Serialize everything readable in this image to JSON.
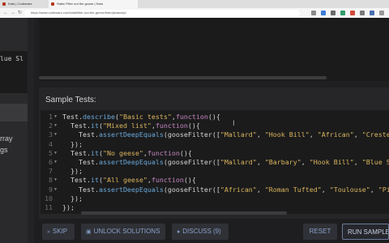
{
  "browser": {
    "tabs": [
      {
        "label": "Kata | Codewars"
      },
      {
        "label": "Static Filter not the goose | Kata"
      }
    ],
    "url": "https://www.codewars.com/kata/filter-out-the-geese/train/javascript"
  },
  "left_panel": {
    "code_fragment": "lue Sl",
    "text_lines": [
      "rray",
      "gs"
    ]
  },
  "tests": {
    "title": "Sample Tests:",
    "lines": [
      {
        "n": "1",
        "fold": true,
        "segments": [
          [
            "id",
            "Test."
          ],
          [
            "fn",
            "describe"
          ],
          [
            "id",
            "("
          ],
          [
            "str",
            "\"Basic tests\""
          ],
          [
            "id",
            ","
          ],
          [
            "kw",
            "function"
          ],
          [
            "id",
            "(){"
          ]
        ]
      },
      {
        "n": "2",
        "fold": true,
        "segments": [
          [
            "id",
            "  Test."
          ],
          [
            "fn",
            "it"
          ],
          [
            "id",
            "("
          ],
          [
            "str",
            "\"Mixed list\""
          ],
          [
            "id",
            ","
          ],
          [
            "kw",
            "function"
          ],
          [
            "id",
            "(){"
          ]
        ]
      },
      {
        "n": "3",
        "fold": true,
        "segments": [
          [
            "id",
            "    Test."
          ],
          [
            "fn",
            "assertDeepEquals"
          ],
          [
            "id",
            "(gooseFilter(["
          ],
          [
            "str",
            "\"Mallard\""
          ],
          [
            "id",
            ", "
          ],
          [
            "str",
            "\"Hook Bill\""
          ],
          [
            "id",
            ", "
          ],
          [
            "str",
            "\"African\""
          ],
          [
            "id",
            ", "
          ],
          [
            "str",
            "\"Crested\""
          ]
        ]
      },
      {
        "n": "4",
        "fold": false,
        "segments": [
          [
            "id",
            "  });"
          ]
        ]
      },
      {
        "n": "5",
        "fold": true,
        "segments": [
          [
            "id",
            "  Test."
          ],
          [
            "fn",
            "it"
          ],
          [
            "id",
            "("
          ],
          [
            "str",
            "\"No geese\""
          ],
          [
            "id",
            ","
          ],
          [
            "kw",
            "function"
          ],
          [
            "id",
            "(){"
          ]
        ]
      },
      {
        "n": "6",
        "fold": true,
        "segments": [
          [
            "id",
            "    Test."
          ],
          [
            "fn",
            "assertDeepEquals"
          ],
          [
            "id",
            "(gooseFilter(["
          ],
          [
            "str",
            "\"Mallard\""
          ],
          [
            "id",
            ", "
          ],
          [
            "str",
            "\"Barbary\""
          ],
          [
            "id",
            ", "
          ],
          [
            "str",
            "\"Hook Bill\""
          ],
          [
            "id",
            ", "
          ],
          [
            "str",
            "\"Blue Sw"
          ]
        ]
      },
      {
        "n": "7",
        "fold": false,
        "segments": [
          [
            "id",
            "  });"
          ]
        ]
      },
      {
        "n": "8",
        "fold": true,
        "segments": [
          [
            "id",
            "  Test."
          ],
          [
            "fn",
            "it"
          ],
          [
            "id",
            "("
          ],
          [
            "str",
            "\"All geese\""
          ],
          [
            "id",
            ","
          ],
          [
            "kw",
            "function"
          ],
          [
            "id",
            "(){"
          ]
        ]
      },
      {
        "n": "9",
        "fold": true,
        "segments": [
          [
            "id",
            "    Test."
          ],
          [
            "fn",
            "assertDeepEquals"
          ],
          [
            "id",
            "(gooseFilter(["
          ],
          [
            "str",
            "\"African\""
          ],
          [
            "id",
            ", "
          ],
          [
            "str",
            "\"Roman Tufted\""
          ],
          [
            "id",
            ", "
          ],
          [
            "str",
            "\"Toulouse\""
          ],
          [
            "id",
            ", "
          ],
          [
            "str",
            "\"Pil"
          ]
        ]
      },
      {
        "n": "10",
        "fold": false,
        "segments": [
          [
            "id",
            "  });"
          ]
        ]
      },
      {
        "n": "11",
        "fold": false,
        "segments": [
          [
            "id",
            "});"
          ]
        ]
      }
    ]
  },
  "actions": {
    "skip": "SKIP",
    "unlock": "UNLOCK SOLUTIONS",
    "discuss": "DISCUSS (9)",
    "reset": "RESET",
    "run": "RUN SAMPLE TESTS"
  },
  "colors": {
    "background": "#1f1f21",
    "accent": "#8aa0c8",
    "string": "#d9b45c",
    "function": "#6aa8d8"
  }
}
